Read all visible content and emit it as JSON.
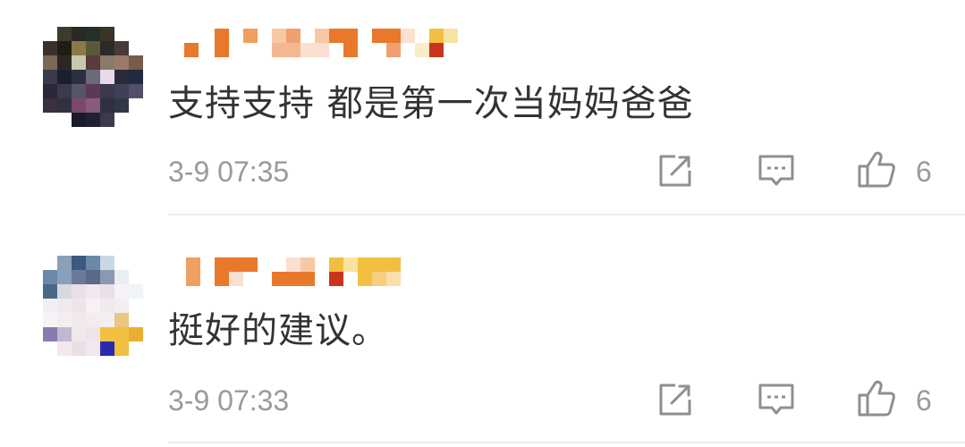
{
  "comments": [
    {
      "text": "支持支持 都是第一次当妈妈爸爸",
      "timestamp": "3-9 07:35",
      "like_count": "6"
    },
    {
      "text": "挺好的建议。",
      "timestamp": "3-9 07:33",
      "like_count": "6"
    }
  ],
  "icons": {
    "share": "share-icon",
    "reply": "comment-icon",
    "like": "thumbs-up-icon"
  },
  "colors": {
    "text": "#333333",
    "meta": "#9a9a9a",
    "icon": "#8f8f8f",
    "divider": "#ececec"
  }
}
